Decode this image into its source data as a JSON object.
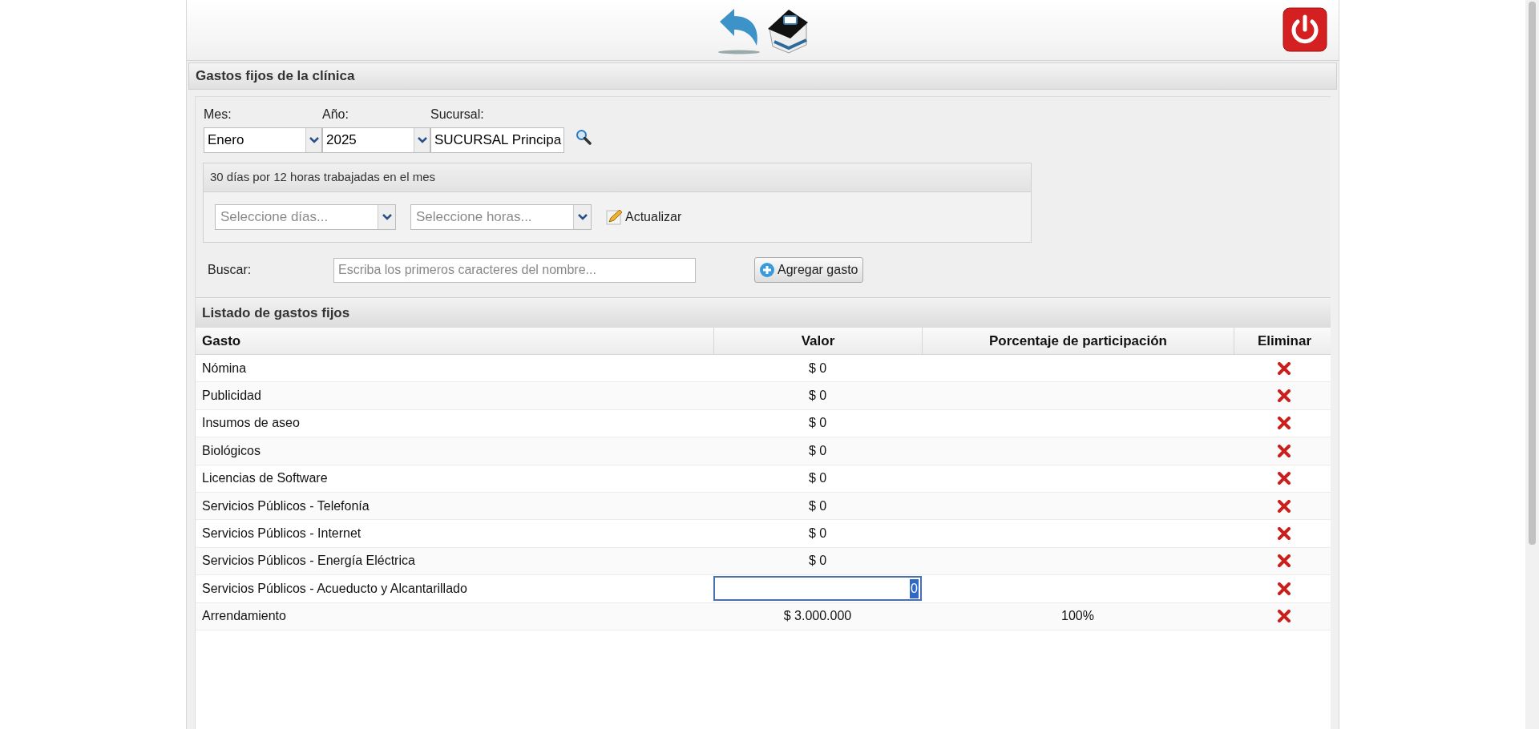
{
  "top_bar": {
    "buttons": [
      {
        "kind": "back"
      },
      {
        "kind": "home"
      },
      {
        "kind": "power"
      }
    ]
  },
  "panel": {
    "title": "Gastos fijos de la clínica"
  },
  "filters": {
    "mes": {
      "label": "Mes:",
      "value": "Enero"
    },
    "anio": {
      "label": "Año:",
      "value": "2025"
    },
    "sucursal": {
      "label": "Sucursal:",
      "value": "SUCURSAL Principa"
    }
  },
  "hours": {
    "summary": "30 días por 12 horas trabajadas en el mes",
    "dias_placeholder": "Seleccione días...",
    "horas_placeholder": "Seleccione horas...",
    "update_button": "Actualizar"
  },
  "search": {
    "label": "Buscar:",
    "placeholder": "Escriba los primeros caracteres del nombre...",
    "add_button": "Agregar gasto"
  },
  "table": {
    "title": "Listado de gastos fijos",
    "columns": [
      "Gasto",
      "Valor",
      "Porcentaje de participación",
      "Eliminar"
    ],
    "rows": [
      {
        "gasto": "Nómina",
        "kind": "text",
        "valor": "$ 0"
      },
      {
        "gasto": "Publicidad",
        "kind": "text",
        "valor": "$ 0"
      },
      {
        "gasto": "Insumos de aseo",
        "kind": "text",
        "valor": "$ 0"
      },
      {
        "gasto": "Biológicos",
        "kind": "text",
        "valor": "$ 0"
      },
      {
        "gasto": "Licencias de Software",
        "kind": "text",
        "valor": "$ 0"
      },
      {
        "gasto": "Servicios Públicos - Telefonía",
        "kind": "text",
        "valor": "$ 0"
      },
      {
        "gasto": "Servicios Públicos - Internet",
        "kind": "text",
        "valor": "$ 0"
      },
      {
        "gasto": "Servicios Públicos - Energía Eléctrica",
        "kind": "text",
        "valor": "$ 0"
      },
      {
        "gasto": "Servicios Públicos - Acueducto y Alcantarillado",
        "kind": "input",
        "valor": "0"
      },
      {
        "gasto": "Arrendamiento",
        "kind": "text",
        "valor": "$ 3.000.000",
        "porcentaje": "100%"
      }
    ]
  }
}
